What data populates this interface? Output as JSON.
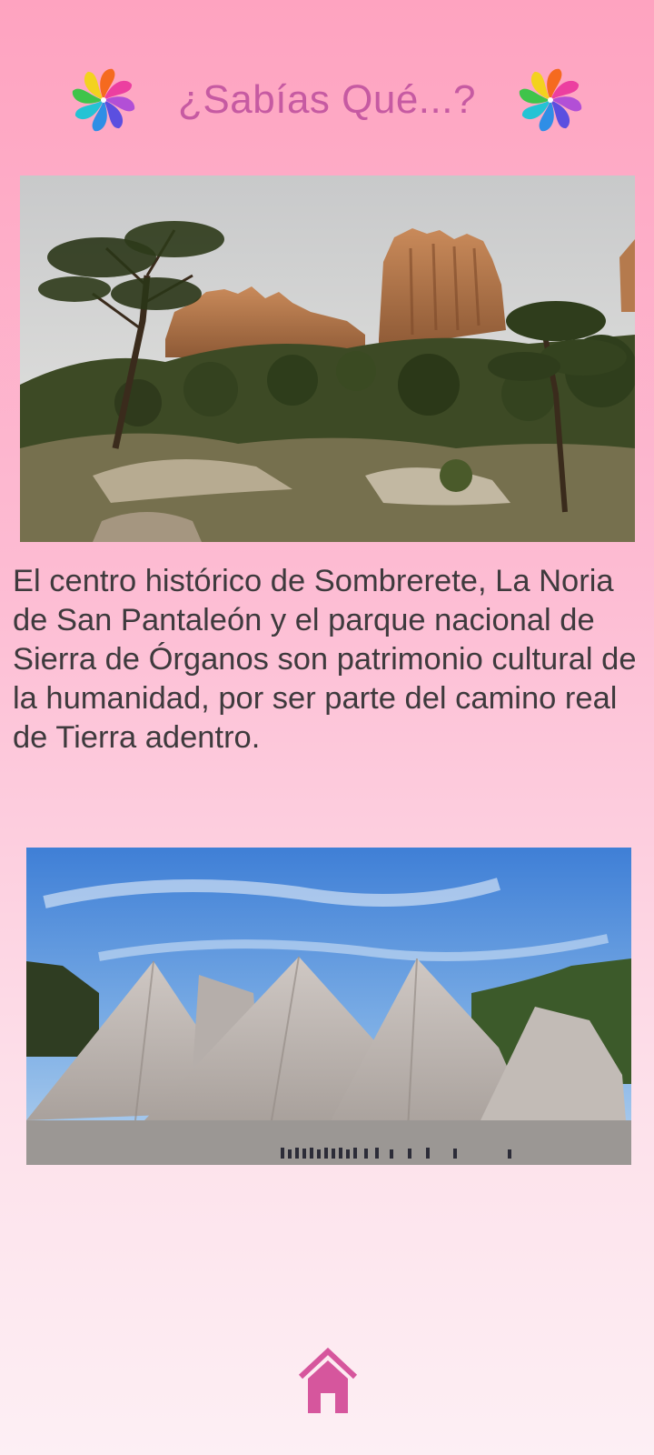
{
  "screen": {
    "title": "¿Sabías Qué...?",
    "fact_text": "El centro histórico de Sombrerete, La Noria de San Pantaleón y el parque nacional de Sierra de Órganos son patrimonio cultural de la humanidad, por ser parte del camino real de Tierra adentro."
  },
  "icons": {
    "decoration": "pinwheel-icon",
    "nav": "home-icon"
  },
  "colors": {
    "title": "#c65aa2",
    "home_icon": "#d6569d",
    "background_top": "#fea3c0",
    "background_bottom": "#fdeff4",
    "body_text": "#3e3a3d"
  }
}
